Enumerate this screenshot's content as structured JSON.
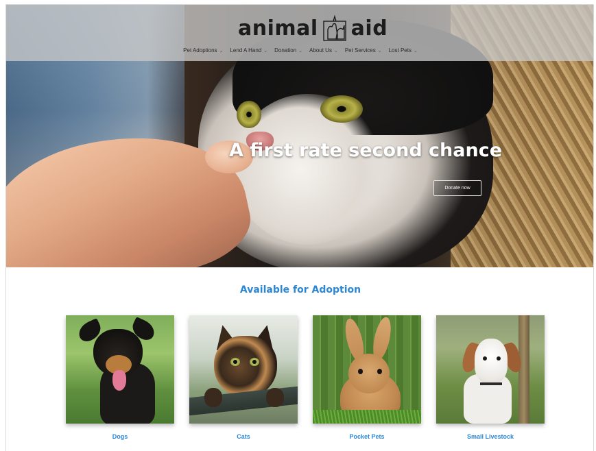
{
  "header": {
    "logo_left": "animal",
    "logo_right": "aid",
    "logo_icon": "dog-cat-logo-icon"
  },
  "nav": {
    "items": [
      {
        "label": "Pet Adoptions",
        "icon": "chevron-down-icon"
      },
      {
        "label": "Lend A Hand",
        "icon": "chevron-down-icon"
      },
      {
        "label": "Donation",
        "icon": "chevron-down-icon"
      },
      {
        "label": "About Us",
        "icon": "chevron-down-icon"
      },
      {
        "label": "Pet Services",
        "icon": "chevron-down-icon"
      },
      {
        "label": "Lost Pets",
        "icon": "chevron-down-icon"
      }
    ],
    "chevron": "⌄"
  },
  "hero": {
    "title": "A first rate second chance",
    "button": "Donate now"
  },
  "adoption": {
    "title": "Available for Adoption",
    "cards": [
      {
        "label": "Dogs"
      },
      {
        "label": "Cats"
      },
      {
        "label": "Pocket Pets"
      },
      {
        "label": "Small Livestock"
      }
    ]
  },
  "colors": {
    "accent": "#2b87d6",
    "header_band": "#c8c8c8",
    "text_dark": "#1c1c1c"
  }
}
